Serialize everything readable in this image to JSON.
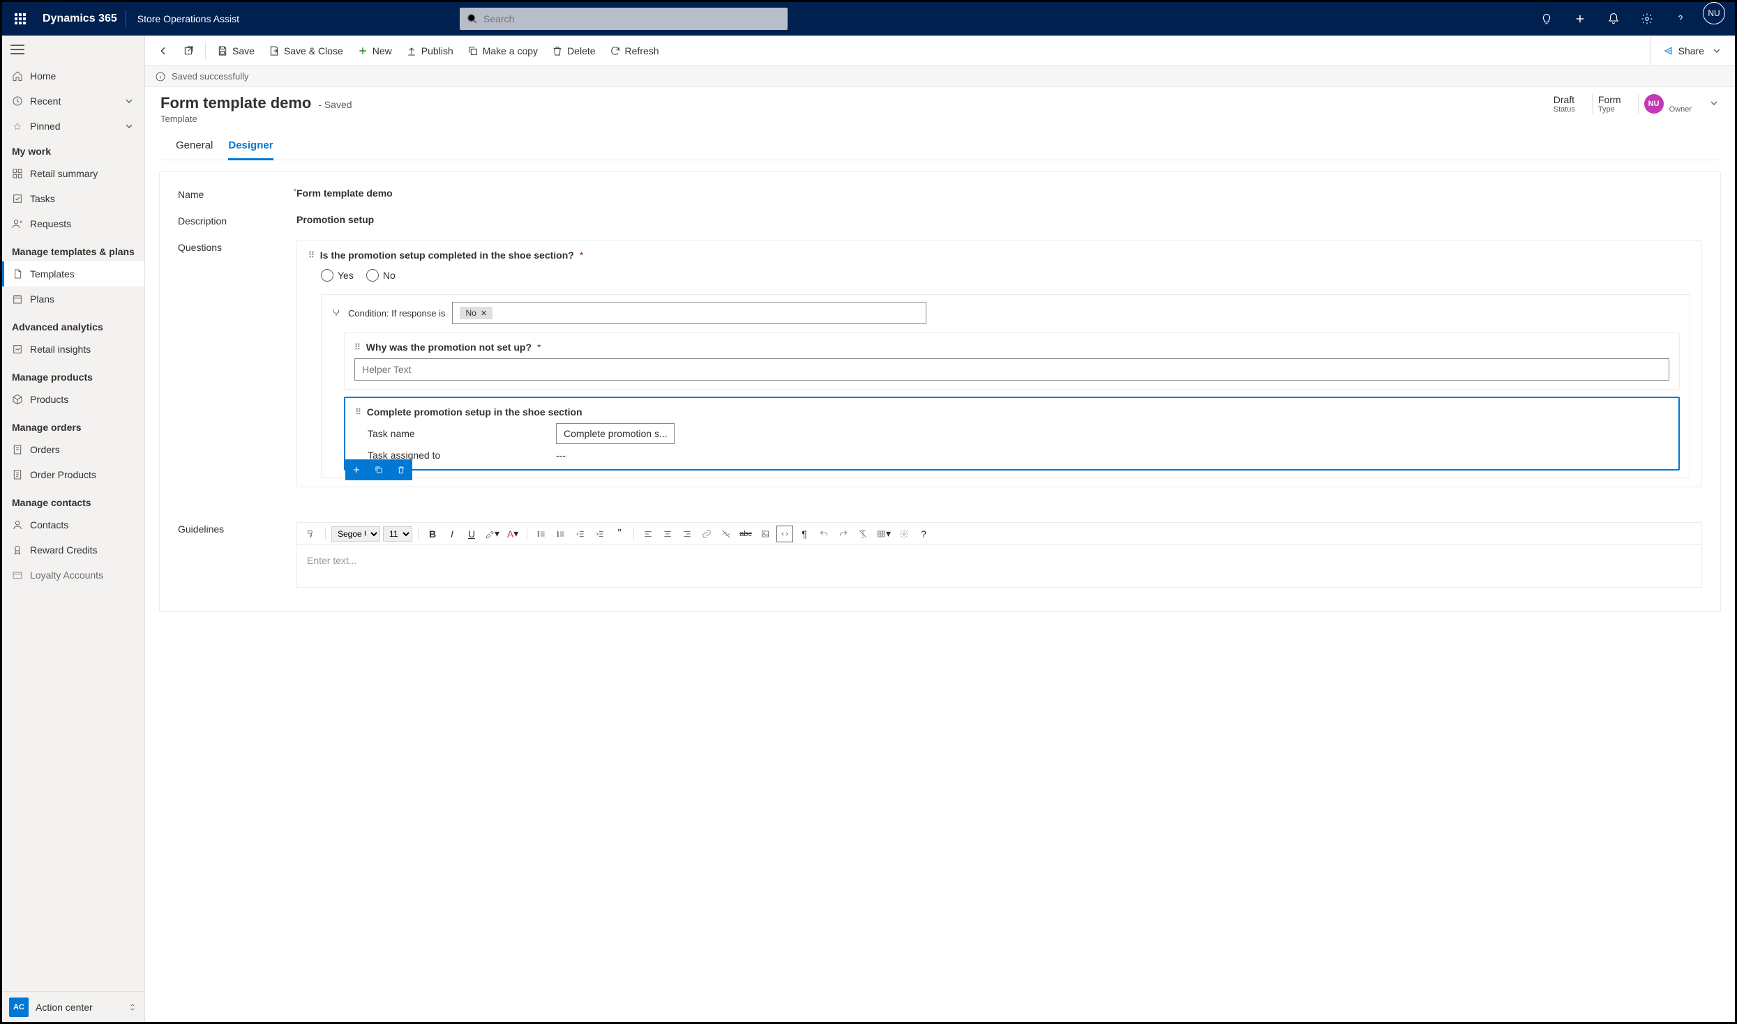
{
  "topbar": {
    "brand": "Dynamics 365",
    "app": "Store Operations Assist",
    "search_placeholder": "Search",
    "avatar": "NU"
  },
  "sidebar": {
    "quick": {
      "home": "Home",
      "recent": "Recent",
      "pinned": "Pinned"
    },
    "sections": {
      "mywork": {
        "title": "My work",
        "items": {
          "retail_summary": "Retail summary",
          "tasks": "Tasks",
          "requests": "Requests"
        }
      },
      "templates_plans": {
        "title": "Manage templates & plans",
        "items": {
          "templates": "Templates",
          "plans": "Plans"
        }
      },
      "analytics": {
        "title": "Advanced analytics",
        "items": {
          "insights": "Retail insights"
        }
      },
      "products": {
        "title": "Manage products",
        "items": {
          "products": "Products"
        }
      },
      "orders": {
        "title": "Manage orders",
        "items": {
          "orders": "Orders",
          "order_products": "Order Products"
        }
      },
      "contacts": {
        "title": "Manage contacts",
        "items": {
          "contacts": "Contacts",
          "reward": "Reward Credits",
          "loyalty": "Loyalty Accounts"
        }
      }
    },
    "footer": {
      "badge": "AC",
      "label": "Action center"
    }
  },
  "commandbar": {
    "save": "Save",
    "save_close": "Save & Close",
    "new": "New",
    "publish": "Publish",
    "copy": "Make a copy",
    "delete": "Delete",
    "refresh": "Refresh",
    "share": "Share"
  },
  "notification": {
    "text": "Saved successfully"
  },
  "header": {
    "title": "Form template demo",
    "suffix": "- Saved",
    "subtitle": "Template",
    "status": {
      "value": "Draft",
      "label": "Status"
    },
    "type": {
      "value": "Form",
      "label": "Type"
    },
    "owner": {
      "avatar": "NU",
      "label": "Owner"
    },
    "tabs": {
      "general": "General",
      "designer": "Designer"
    }
  },
  "form": {
    "name_label": "Name",
    "name_value": "Form template demo",
    "desc_label": "Description",
    "desc_value": "Promotion setup",
    "questions_label": "Questions",
    "q1": {
      "text": "Is the promotion setup completed in the shoe section?",
      "yes": "Yes",
      "no": "No",
      "cond_prefix": "Condition: If response is",
      "cond_value": "No"
    },
    "subq": {
      "text": "Why was the promotion not set up?",
      "placeholder": "Helper Text"
    },
    "task": {
      "title": "Complete promotion setup in the shoe section",
      "name_label": "Task name",
      "name_value": "Complete promotion s...",
      "assigned_label": "Task assigned to",
      "assigned_value": "---"
    },
    "guidelines_label": "Guidelines",
    "rte": {
      "font": "Segoe UI",
      "size": "11",
      "placeholder": "Enter text..."
    }
  }
}
